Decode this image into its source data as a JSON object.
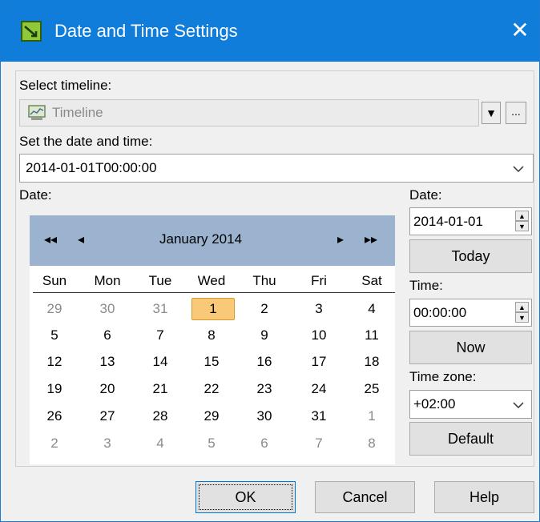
{
  "window": {
    "title": "Date and Time Settings",
    "close_glyph": "✕",
    "icon": "clock-settings-icon"
  },
  "timeline": {
    "label": "Select timeline:",
    "value": "Timeline",
    "icon": "timeline-chart-icon",
    "dropdown_glyph": "▼",
    "more_label": "..."
  },
  "datetime": {
    "label": "Set the date and time:",
    "value": "2014-01-01T00:00:00"
  },
  "calendar": {
    "label": "Date:",
    "month_label": "January  2014",
    "nav": {
      "prev_year": "◂◂",
      "prev_month": "◂",
      "next_month": "▸",
      "next_year": "▸▸"
    },
    "weekdays": [
      "Sun",
      "Mon",
      "Tue",
      "Wed",
      "Thu",
      "Fri",
      "Sat"
    ],
    "weeks": [
      [
        "29",
        "30",
        "31",
        "1",
        "2",
        "3",
        "4"
      ],
      [
        "5",
        "6",
        "7",
        "8",
        "9",
        "10",
        "11"
      ],
      [
        "12",
        "13",
        "14",
        "15",
        "16",
        "17",
        "18"
      ],
      [
        "19",
        "20",
        "21",
        "22",
        "23",
        "24",
        "25"
      ],
      [
        "26",
        "27",
        "28",
        "29",
        "30",
        "31",
        "1"
      ],
      [
        "2",
        "3",
        "4",
        "5",
        "6",
        "7",
        "8"
      ]
    ],
    "selected_day": "1"
  },
  "side": {
    "date_label": "Date:",
    "date_value": "2014-01-01",
    "today_button": "Today",
    "time_label": "Time:",
    "time_value": "00:00:00",
    "now_button": "Now",
    "timezone_label": "Time zone:",
    "timezone_value": "+02:00",
    "default_button": "Default"
  },
  "footer": {
    "ok": "OK",
    "cancel": "Cancel",
    "help": "Help"
  },
  "colors": {
    "titlebar": "#0f7dd9",
    "calendar_header": "#9bb3cf",
    "selected_day": "#f9c979"
  }
}
